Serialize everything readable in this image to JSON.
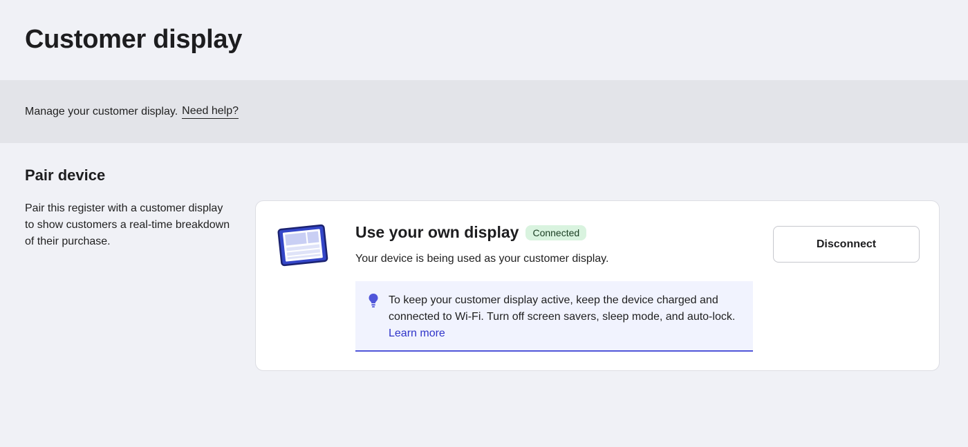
{
  "page": {
    "title": "Customer display"
  },
  "info_bar": {
    "text": "Manage your customer display.",
    "help_link": "Need help?"
  },
  "pair_section": {
    "title": "Pair device",
    "description": "Pair this register with a customer display to show customers a real-time breakdown of their purchase."
  },
  "display_card": {
    "icon": "tablet-display-icon",
    "title": "Use your own display",
    "status": "Connected",
    "description": "Your device is being used as your customer display.",
    "tip": {
      "icon": "lightbulb-icon",
      "text": "To keep your customer display active, keep the device charged and connected to Wi-Fi. Turn off screen savers, sleep mode, and auto-lock.",
      "link": "Learn more"
    },
    "disconnect_label": "Disconnect"
  },
  "colors": {
    "background": "#f0f1f6",
    "info_bar": "#e3e4e9",
    "badge_bg": "#d9f3df",
    "accent": "#4f55d9",
    "link": "#2f34c9"
  }
}
